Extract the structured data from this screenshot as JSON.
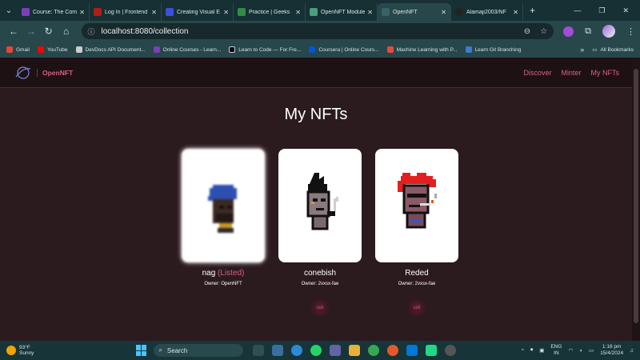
{
  "browser": {
    "tabs": [
      {
        "title": "Course: The Comp",
        "color": "#7b3fb8"
      },
      {
        "title": "Log In | Frontend",
        "color": "#b31b1b"
      },
      {
        "title": "Creating Visual E",
        "color": "#3b52d6"
      },
      {
        "title": "Practice | Geeks",
        "color": "#2f8d46"
      },
      {
        "title": "OpenNFT Module",
        "color": "#4a9e7a"
      },
      {
        "title": "OpenNFT",
        "color": "#3a6166",
        "active": true
      },
      {
        "title": "Alamaji2003/NF",
        "color": "#222222"
      }
    ],
    "url": "localhost:8080/collection",
    "bookmarks": [
      {
        "label": "Gmail",
        "color": "#ea4335"
      },
      {
        "label": "YouTube",
        "color": "#ff0000"
      },
      {
        "label": "DevDocs API Document...",
        "color": "#cccccc"
      },
      {
        "label": "Online Courses - Learn...",
        "color": "#7b3fb8"
      },
      {
        "label": "Learn to Code — For Fre...",
        "color": "#0a0a23"
      },
      {
        "label": "Coursera | Online Cours...",
        "color": "#0056d2"
      },
      {
        "label": "Machine Learning with P...",
        "color": "#e84a3c"
      },
      {
        "label": "Learn Git Branching",
        "color": "#3a7bd5"
      }
    ],
    "all_bookmarks": "All Bookmarks"
  },
  "app": {
    "brand": "OpenNFT",
    "nav": [
      "Discover",
      "Minter",
      "My NFTs"
    ],
    "heading": "My NFTs",
    "nfts": [
      {
        "name": "nag",
        "status": "(Listed)",
        "owner": "Owner: OpenNFT",
        "sell": "",
        "blur": true
      },
      {
        "name": "conebish",
        "status": "",
        "owner": "Owner: 2vxsx-fae",
        "sell": "sell",
        "blur": false
      },
      {
        "name": "Reded",
        "status": "",
        "owner": "Owner: 2vxsx-fae",
        "sell": "sell",
        "blur": false
      }
    ],
    "accent": "#d9608e"
  },
  "taskbar": {
    "temp": "93°F",
    "weather": "Sunny",
    "search": "Search",
    "lang": "ENG",
    "region": "IN",
    "time": "1:16 pm",
    "date": "15/4/2024"
  }
}
